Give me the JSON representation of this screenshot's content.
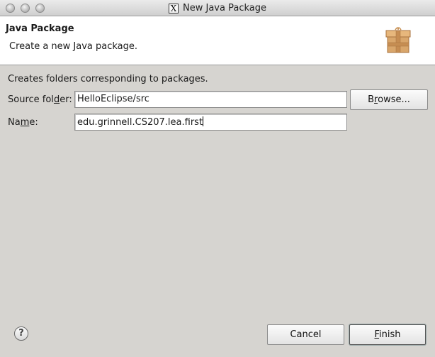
{
  "window": {
    "title": "New Java Package"
  },
  "banner": {
    "title": "Java Package",
    "description": "Create a new Java package."
  },
  "form": {
    "info": "Creates folders corresponding to packages.",
    "source_label_a": "Source fol",
    "source_label_mn": "d",
    "source_label_b": "er:",
    "source_value": "HelloEclipse/src",
    "browse_a": "B",
    "browse_mn": "r",
    "browse_b": "owse...",
    "name_label_a": "Na",
    "name_label_mn": "m",
    "name_label_b": "e:",
    "name_value": "edu.grinnell.CS207.lea.first"
  },
  "footer": {
    "help_glyph": "?",
    "cancel_label": "Cancel",
    "finish_mn": "F",
    "finish_rest": "inish"
  },
  "icons": {
    "window_app": "X"
  }
}
